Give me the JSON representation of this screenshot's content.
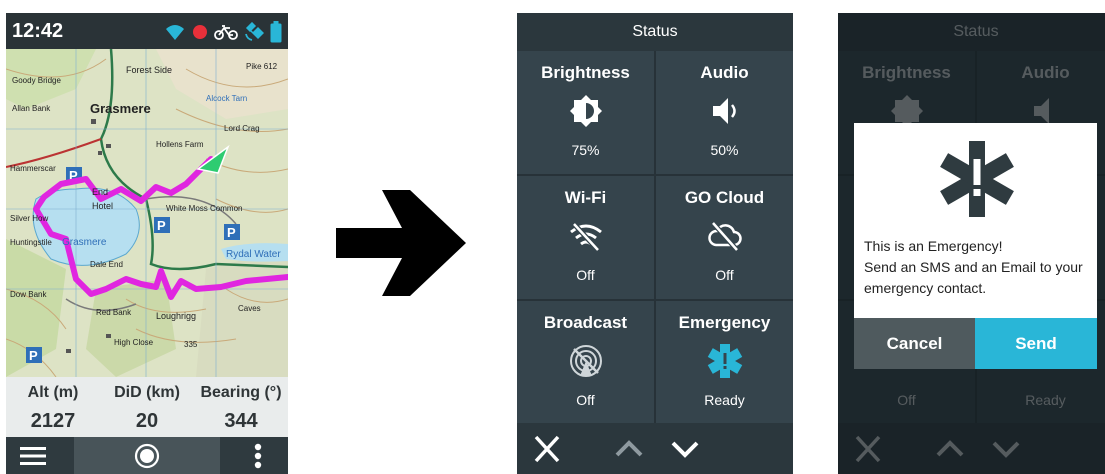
{
  "colors": {
    "panel_bg": "#35444c",
    "accent_cyan": "#29b6d7",
    "track_magenta": "#e026e0",
    "record_red": "#e8303a",
    "cancel_gray": "#4f5a5e"
  },
  "map_screen": {
    "status_bar": {
      "time": "12:42",
      "icons": [
        "wifi-icon",
        "recording-dot-icon",
        "bike-icon",
        "satellite-icon",
        "battery-icon"
      ]
    },
    "map_labels": [
      "Grasmere",
      "Forest Side",
      "Alcock Tarn",
      "Lord Crag",
      "End",
      "Hotel",
      "White Moss Common",
      "Dale End",
      "Rydal Water",
      "Red Bank",
      "Loughrigg",
      "High Close",
      "335",
      "Caves",
      "Pike 612",
      "Goody Bridge",
      "Allan Bank",
      "Hollens Farm",
      "Dow Bank",
      "Huntingstile",
      "Hammerscar",
      "Silver How"
    ],
    "stats": [
      {
        "label": "Alt (m)",
        "value": "2127"
      },
      {
        "label": "DiD (km)",
        "value": "20"
      },
      {
        "label": "Bearing (°)",
        "value": "344"
      }
    ],
    "nav_icons": [
      "menu-icon",
      "record-icon",
      "more-vert-icon"
    ]
  },
  "status_screen": {
    "title": "Status",
    "tiles": [
      {
        "name": "Brightness",
        "value": "75%",
        "icon": "brightness-icon"
      },
      {
        "name": "Audio",
        "value": "50%",
        "icon": "speaker-icon"
      },
      {
        "name": "Wi-Fi",
        "value": "Off",
        "icon": "wifi-off-icon"
      },
      {
        "name": "GO Cloud",
        "value": "Off",
        "icon": "cloud-off-icon"
      },
      {
        "name": "Broadcast",
        "value": "Off",
        "icon": "broadcast-off-icon"
      },
      {
        "name": "Emergency",
        "value": "Ready",
        "icon": "emergency-star-icon"
      }
    ],
    "bottom_icons": [
      "close-icon",
      "chevron-up-icon",
      "chevron-down-icon"
    ]
  },
  "emergency_dialog": {
    "message_lines": [
      "This is an Emergency!",
      "Send an SMS and an Email to your",
      "emergency contact."
    ],
    "cancel_label": "Cancel",
    "send_label": "Send"
  }
}
